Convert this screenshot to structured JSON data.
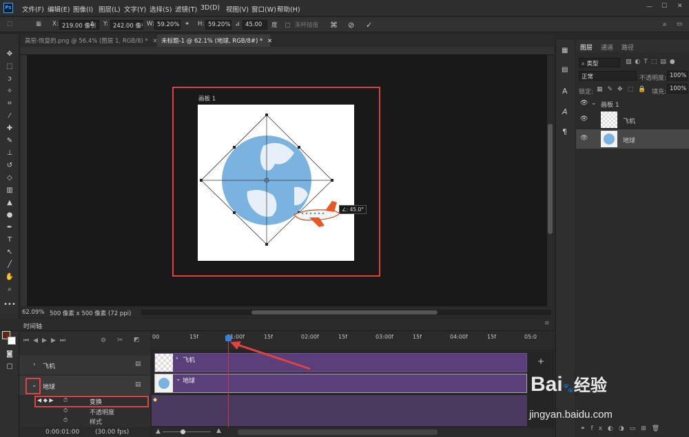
{
  "menu": [
    "文件(F)",
    "编辑(E)",
    "图像(I)",
    "图层(L)",
    "文字(Y)",
    "选择(S)",
    "滤镜(T)",
    "3D(D)",
    "视图(V)",
    "窗口(W)",
    "帮助(H)"
  ],
  "options": {
    "x_label": "X:",
    "x_value": "219.00 像引",
    "y_label": "Y:",
    "y_value": "242.00 像引",
    "w_label": "W:",
    "w_value": "59.20%",
    "h_label": "H:",
    "h_value": "59.20%",
    "angle_value": "45.00",
    "angle_unit": "度",
    "interp": "渐杯插值"
  },
  "tabs": [
    "高窑-恢复的.png @ 56.4% (图层 1, RGB/8) *",
    "未标题-1 @ 62.1% (地球, RGB/8#) *"
  ],
  "canvas": {
    "artboard_label": "画板 1",
    "angle_tip": "∠: 45.0°"
  },
  "status": {
    "zoom": "62.09%",
    "doc": "500 像素 x 500 像素 (72 ppi)"
  },
  "timeline": {
    "title": "时间轴",
    "ruler": [
      "00",
      "15f",
      "01:00f",
      "15f",
      "02:00f",
      "15f",
      "03:00f",
      "15f",
      "04:00f",
      "15f",
      "05:0"
    ],
    "tracks": [
      {
        "name": "飞机"
      },
      {
        "name": "地球"
      }
    ],
    "props": [
      "变换",
      "不透明度",
      "样式"
    ],
    "time": "0:00:01:00",
    "fps": "(30.00 fps)"
  },
  "layers_panel": {
    "tabs": [
      "图层",
      "通道",
      "路径"
    ],
    "filter": "类型",
    "blend": "正常",
    "opacity_label": "不透明度:",
    "opacity": "100%",
    "lock_label": "锁定:",
    "fill_label": "填充:",
    "fill": "100%",
    "group": "画板 1",
    "layers": [
      "飞机",
      "地球"
    ]
  },
  "watermark": {
    "brand": "Bai",
    "brand_cn": "经验",
    "url": "jingyan.baidu.com"
  }
}
